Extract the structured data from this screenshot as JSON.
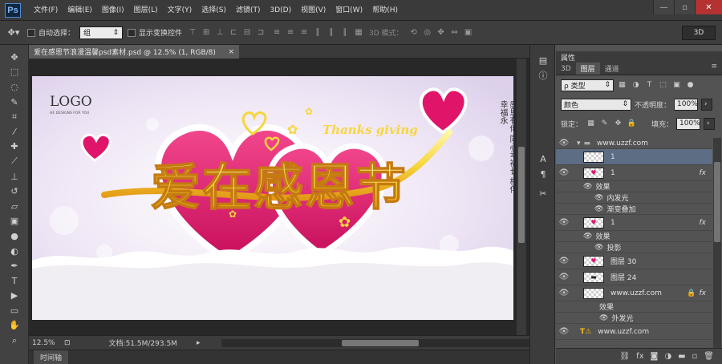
{
  "app": {
    "logo": "Ps"
  },
  "menu": [
    "文件(F)",
    "编辑(E)",
    "图像(I)",
    "图层(L)",
    "文字(Y)",
    "选择(S)",
    "滤镜(T)",
    "3D(D)",
    "视图(V)",
    "窗口(W)",
    "帮助(H)"
  ],
  "window_controls": {
    "minimize": "—",
    "restore": "▫",
    "close": "✕"
  },
  "options": {
    "auto_select_label": "自动选择：",
    "auto_select_value": "组",
    "show_transform_label": "显示变换控件",
    "mode_3d_label": "3D 模式：",
    "btn_3d": "3D"
  },
  "document": {
    "tab_title": "爱在感恩节浪漫温馨psd素材.psd @ 12.5% (1, RGB/8)",
    "tab_close": "×",
    "zoom": "12.5%",
    "doc_size": "文档:51.5M/293.5M"
  },
  "artwork": {
    "logo": "LOGO",
    "logo_sub": "HE DESIGNS FOR YOU",
    "main_title": "爱在感恩节",
    "thanks": "Thanks giving",
    "vertical_text": "感恩有你 同心幸福长 相伴幸福永",
    "colors": {
      "heart": "#e0156a",
      "gold": "#f7d63c",
      "background": "#f6f2f9"
    }
  },
  "timeline": {
    "label": "时间轴"
  },
  "panel": {
    "properties_tab": "属性",
    "tabs": [
      "3D",
      "图层",
      "通道"
    ],
    "active_tab": "图层",
    "filter_label": "ρ 类型",
    "blend_mode": "颜色",
    "opacity_label": "不透明度：",
    "opacity_value": "100%",
    "lock_label": "锁定：",
    "fill_label": "填充：",
    "fill_value": "100%"
  },
  "layers": [
    {
      "kind": "group",
      "name": "www.uzzf.com"
    },
    {
      "kind": "layer",
      "name": "1",
      "selected": true
    },
    {
      "kind": "layer",
      "name": "1",
      "fx": "fx"
    },
    {
      "kind": "effects",
      "name": "效果"
    },
    {
      "kind": "effect",
      "name": "内发光"
    },
    {
      "kind": "effect",
      "name": "渐变叠加"
    },
    {
      "kind": "layer",
      "name": "1",
      "fx": "fx"
    },
    {
      "kind": "effects",
      "name": "效果"
    },
    {
      "kind": "effect",
      "name": "投影"
    },
    {
      "kind": "layer",
      "name": "图层 30"
    },
    {
      "kind": "layer",
      "name": "图层 24"
    },
    {
      "kind": "layer",
      "name": "www.uzzf.com",
      "fx": "fx"
    },
    {
      "kind": "effects",
      "name": "效果"
    },
    {
      "kind": "effect",
      "name": "外发光"
    },
    {
      "kind": "text",
      "name": "www.uzzf.com"
    }
  ]
}
